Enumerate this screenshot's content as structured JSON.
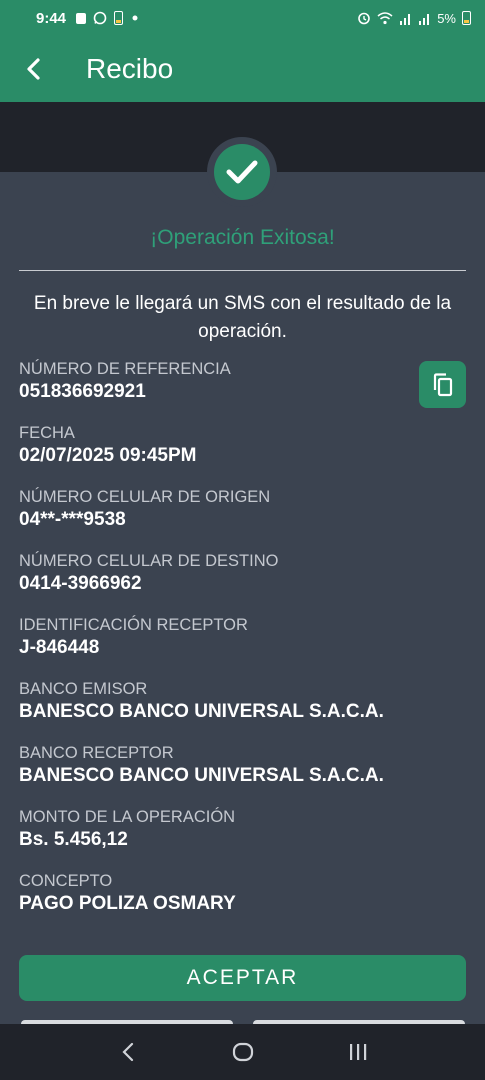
{
  "status_bar": {
    "time": "9:44",
    "battery": "5%",
    "notification_icons": [
      "app-icon",
      "whatsapp-icon",
      "battery-alert-icon",
      "dot-icon"
    ],
    "system_icons": [
      "alarm-icon",
      "wifi-icon",
      "signal-icon",
      "signal-icon",
      "battery-icon"
    ]
  },
  "app_bar": {
    "title": "Recibo",
    "back_icon": "chevron-left-icon"
  },
  "success": {
    "icon": "check-icon",
    "title": "¡Operación Exitosa!",
    "message": "En breve le llegará un SMS con el resultado de la operación."
  },
  "fields": [
    {
      "label": "NÚMERO DE REFERENCIA",
      "value": "051836692921"
    },
    {
      "label": "FECHA",
      "value": "02/07/2025 09:45PM"
    },
    {
      "label": "NÚMERO CELULAR DE ORIGEN",
      "value": "04**-***9538"
    },
    {
      "label": "NÚMERO CELULAR DE DESTINO",
      "value": "0414-3966962"
    },
    {
      "label": "IDENTIFICACIÓN RECEPTOR",
      "value": "J-846448"
    },
    {
      "label": "BANCO EMISOR",
      "value": "BANESCO BANCO UNIVERSAL S.A.C.A."
    },
    {
      "label": "BANCO RECEPTOR",
      "value": "BANESCO BANCO UNIVERSAL S.A.C.A."
    },
    {
      "label": "MONTO DE LA OPERACIÓN",
      "value": "Bs. 5.456,12"
    },
    {
      "label": "CONCEPTO",
      "value": "PAGO POLIZA OSMARY"
    }
  ],
  "copy_icon": "copy-icon",
  "accept_button": {
    "label": "ACEPTAR"
  },
  "nav_bar": {
    "icons": [
      "back-nav-icon",
      "home-icon",
      "recents-icon"
    ]
  },
  "colors": {
    "brand_green": "#2a8c67",
    "success_text": "#2fa079",
    "background": "#3b4350",
    "dark": "#20232a"
  }
}
